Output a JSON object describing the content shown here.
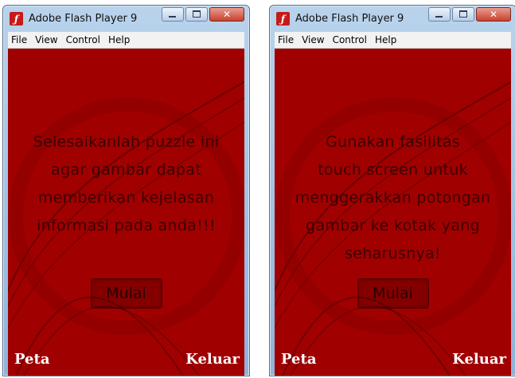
{
  "windows": [
    {
      "title": "Adobe Flash Player 9",
      "menu": [
        "File",
        "View",
        "Control",
        "Help"
      ],
      "message_lines": [
        "Selesaikanlah puzzle ini",
        "agar gambar dapat",
        "memberikan kejelasan",
        "informasi pada anda!!!"
      ],
      "start_button": "Mulai",
      "map_label": "Peta",
      "exit_label": "Keluar"
    },
    {
      "title": "Adobe Flash Player 9",
      "menu": [
        "File",
        "View",
        "Control",
        "Help"
      ],
      "message_lines": [
        "Gunakan fasilitas",
        "touch screen untuk",
        "menggerakkan potongan",
        "gambar ke kotak yang",
        "seharusnya!"
      ],
      "start_button": "Mulai",
      "map_label": "Peta",
      "exit_label": "Keluar"
    }
  ],
  "colors": {
    "stage_background": "#a10000",
    "menubar": "#f2f2f2",
    "titlebar": "#b9d3ec"
  }
}
